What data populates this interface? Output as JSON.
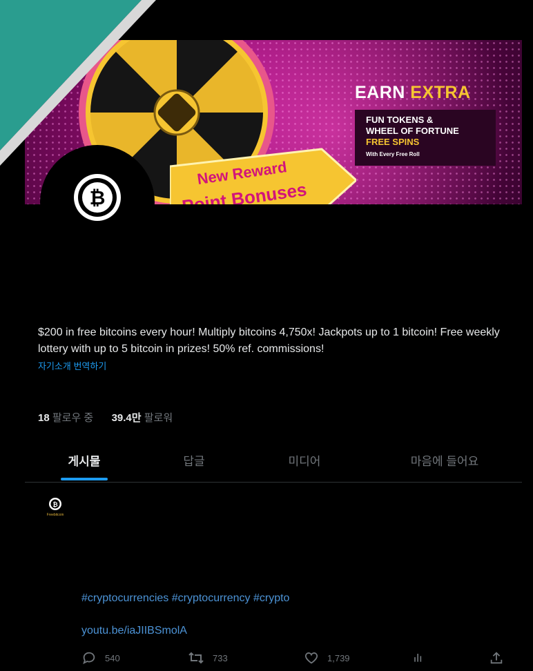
{
  "banner": {
    "earn": "EARN",
    "extra": "EXTRA",
    "line1": "FUN TOKENS &",
    "line2": "WHEEL OF FORTUNE",
    "line3": "FREE SPINS",
    "line4": "With Every Free Roll",
    "ribbon_line1": "New Reward",
    "ribbon_line2": "Point Bonuses"
  },
  "profile": {
    "avatar_icon": "bitcoin-logo",
    "bio": "$200 in free bitcoins every hour! Multiply bitcoins 4,750x! Jackpots up to 1 bitcoin! Free weekly lottery with up to 5 bitcoin in prizes! 50% ref. commissions!",
    "translate_label": "자기소개 번역하기",
    "following_count": "18",
    "following_label": "팔로우 중",
    "followers_count": "39.4만",
    "followers_label": "팔로워"
  },
  "tabs": [
    {
      "label": "게시물",
      "active": true
    },
    {
      "label": "답글",
      "active": false
    },
    {
      "label": "미디어",
      "active": false
    },
    {
      "label": "마음에 들어요",
      "active": false
    }
  ],
  "post": {
    "avatar_caption": "Freebitcoin",
    "hashtags": "#cryptocurrencies #cryptocurrency #crypto",
    "link": "youtu.be/iaJIIBSmolA",
    "reply_count": "540",
    "retweet_count": "733",
    "like_count": "1,739"
  },
  "colors": {
    "accent": "#1d9bf0",
    "corner_teal": "#2a9d8f",
    "banner_magenta": "#b4148e",
    "banner_gold": "#f6c531"
  }
}
